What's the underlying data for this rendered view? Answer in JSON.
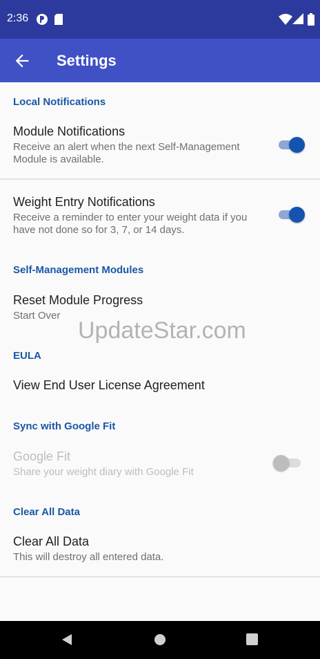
{
  "status_bar": {
    "time": "2:36",
    "icons": [
      "app-notification-icon",
      "sd-card-icon",
      "wifi-icon",
      "signal-icon",
      "battery-icon"
    ]
  },
  "app_bar": {
    "title": "Settings",
    "back_icon": "arrow-back-icon"
  },
  "sections": {
    "local_notifications": {
      "header": "Local Notifications",
      "module": {
        "title": "Module Notifications",
        "summary": "Receive an alert when the next Self-Management Module is available.",
        "enabled": true
      },
      "weight": {
        "title": "Weight Entry Notifications",
        "summary": "Receive a reminder to enter your weight data if you have not done so for 3, 7, or 14 days.",
        "enabled": true
      }
    },
    "self_management": {
      "header": "Self-Management Modules",
      "reset": {
        "title": "Reset Module Progress",
        "summary": "Start Over"
      }
    },
    "eula": {
      "header": "EULA",
      "view": {
        "title": "View End User License Agreement"
      }
    },
    "google_fit": {
      "header": "Sync with Google Fit",
      "item": {
        "title": "Google Fit",
        "summary": "Share your weight diary with Google Fit",
        "enabled": false
      }
    },
    "clear": {
      "header": "Clear All Data",
      "item": {
        "title": "Clear All Data",
        "summary": "This will destroy all entered data."
      }
    }
  },
  "watermark": "UpdateStar.com",
  "colors": {
    "status_bar": "#2c3a9e",
    "app_bar": "#3f51c4",
    "category_text": "#1b57a5",
    "switch_on": "#1454b0"
  },
  "nav_bar": {
    "icons": [
      "back-triangle-icon",
      "home-circle-icon",
      "recents-square-icon"
    ]
  }
}
